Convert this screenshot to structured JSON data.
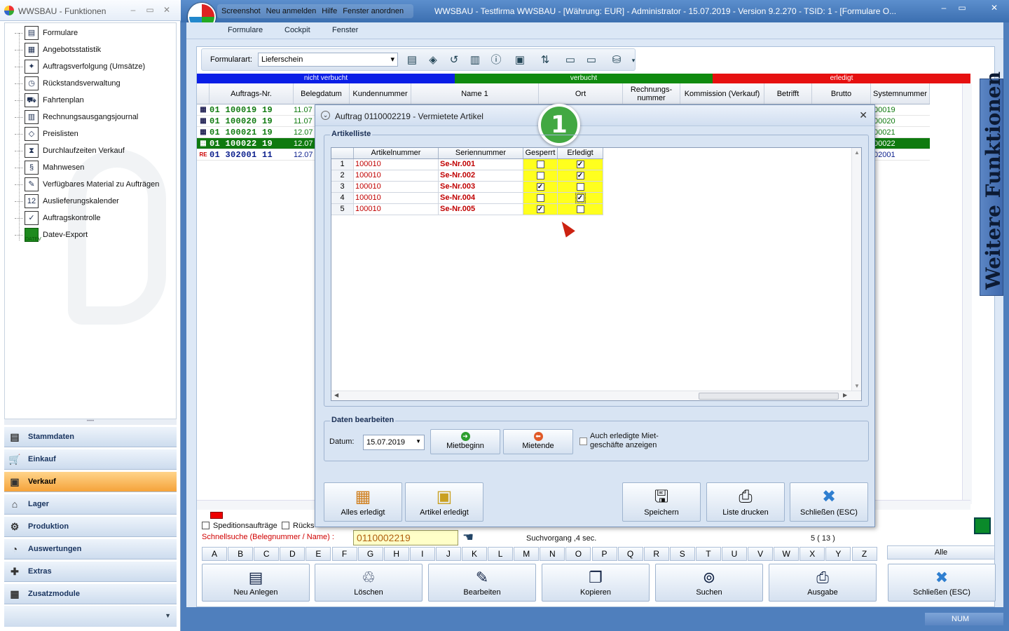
{
  "left_window": {
    "title": "WWSBAU - Funktionen",
    "tree": [
      {
        "label": "Formulare",
        "icon": "document-icon"
      },
      {
        "label": "Angebotsstatistik",
        "icon": "statistics-icon"
      },
      {
        "label": "Auftragsverfolgung (Umsätze)",
        "icon": "tracking-icon"
      },
      {
        "label": "Rückstandsverwaltung",
        "icon": "backlog-icon"
      },
      {
        "label": "Fahrtenplan",
        "icon": "truck-icon"
      },
      {
        "label": "Rechnungsausgangsjournal",
        "icon": "journal-icon"
      },
      {
        "label": "Preislisten",
        "icon": "price-tag-icon"
      },
      {
        "label": "Durchlaufzeiten Verkauf",
        "icon": "hourglass-icon"
      },
      {
        "label": "Mahnwesen",
        "icon": "dunning-icon"
      },
      {
        "label": "Verfügbares Material zu Aufträgen",
        "icon": "material-icon"
      },
      {
        "label": "Auslieferungskalender",
        "icon": "calendar-icon"
      },
      {
        "label": "Auftragskontrolle",
        "icon": "clipboard-check-icon"
      },
      {
        "label": "Datev-Export",
        "icon": "datev-icon",
        "icon_text": "DATEV"
      }
    ],
    "nav": [
      {
        "label": "Stammdaten",
        "icon": "master-data-icon",
        "active": false
      },
      {
        "label": "Einkauf",
        "icon": "cart-icon",
        "active": false
      },
      {
        "label": "Verkauf",
        "icon": "cash-register-icon",
        "active": true
      },
      {
        "label": "Lager",
        "icon": "warehouse-icon",
        "active": false
      },
      {
        "label": "Produktion",
        "icon": "production-icon",
        "active": false
      },
      {
        "label": "Auswertungen",
        "icon": "analysis-icon",
        "active": false
      },
      {
        "label": "Extras",
        "icon": "plus-tools-icon",
        "active": false
      },
      {
        "label": "Zusatzmodule",
        "icon": "modules-icon",
        "active": false
      }
    ]
  },
  "main_window": {
    "quick_access": [
      "Screenshot",
      "Neu anmelden",
      "Hilfe",
      "Fenster anordnen"
    ],
    "title": "WWSBAU - Testfirma WWSBAU - [Währung: EUR] - Administrator - 15.07.2019 - Version 9.2.270 - TSID: 1 - [Formulare O...",
    "menu": [
      "Formulare",
      "Cockpit",
      "Fenster"
    ],
    "toolbar": {
      "formularart_label": "Formularart:",
      "formularart_value": "Lieferschein"
    },
    "status_legend": [
      {
        "label": "nicht verbucht",
        "color": "#0a1ee6"
      },
      {
        "label": "verbucht",
        "color": "#0f8a0f"
      },
      {
        "label": "erledigt",
        "color": "#e61010"
      }
    ],
    "columns": [
      "Auftrags-Nr.",
      "Belegdatum",
      "Kundennummer",
      "Name 1",
      "Ort",
      "Rechnungs-nummer",
      "Kommission (Verkauf)",
      "Betrifft",
      "Brutto",
      "Systemnummer"
    ],
    "rows": [
      {
        "nr": "01 100019 19",
        "datum": "11.07",
        "system": "00019",
        "color": "#0f7a0f",
        "selected": false,
        "icon": "grid-icon"
      },
      {
        "nr": "01 100020 19",
        "datum": "11.07",
        "system": "00020",
        "color": "#0f7a0f",
        "selected": false,
        "icon": "grid-icon"
      },
      {
        "nr": "01 100021 19",
        "datum": "12.07",
        "system": "00021",
        "color": "#0f7a0f",
        "selected": false,
        "icon": "grid-icon"
      },
      {
        "nr": "01 100022 19",
        "datum": "12.07",
        "system": "00022",
        "color": "#ffffff",
        "selected": true,
        "icon": "grid-icon"
      },
      {
        "nr": "01 302001 11",
        "datum": "12.07",
        "system": "02001",
        "color": "#0a1e8c",
        "selected": false,
        "icon": "re-icon",
        "icon_text": "RE"
      }
    ],
    "side_tab": "Weitere Funktionen",
    "bottom": {
      "check1": "Speditionsaufträge",
      "check2": "Rücks",
      "quicksearch_label": "Schnellsuche (Belegnummer / Name) :",
      "quicksearch_value": "0110002219",
      "search_status": "Suchvorgang ,4 sec.",
      "count": "5 ( 13 )",
      "letters": [
        "A",
        "B",
        "C",
        "D",
        "E",
        "F",
        "G",
        "H",
        "I",
        "J",
        "K",
        "L",
        "M",
        "N",
        "O",
        "P",
        "Q",
        "R",
        "S",
        "T",
        "U",
        "V",
        "W",
        "X",
        "Y",
        "Z"
      ],
      "all_label": "Alle",
      "buttons": [
        {
          "label": "Neu Anlegen",
          "icon": "new-document-icon"
        },
        {
          "label": "Löschen",
          "icon": "recycle-bin-icon"
        },
        {
          "label": "Bearbeiten",
          "icon": "edit-icon"
        },
        {
          "label": "Kopieren",
          "icon": "copy-icon"
        },
        {
          "label": "Suchen",
          "icon": "binoculars-icon"
        },
        {
          "label": "Ausgabe",
          "icon": "printer-icon"
        },
        {
          "label": "Schließen (ESC)",
          "icon": "close-x-icon"
        }
      ]
    },
    "status_num": "NUM"
  },
  "dialog": {
    "title": "Auftrag 0110002219 - Vermietete Artikel",
    "badge": "1",
    "artikelliste_label": "Artikelliste",
    "columns": [
      "Artikelnummer",
      "Seriennummer",
      "Gesperrt",
      "Erledigt"
    ],
    "rows": [
      {
        "n": "1",
        "artikel": "100010",
        "serie": "Se-Nr.001",
        "gesperrt": false,
        "erledigt": true
      },
      {
        "n": "2",
        "artikel": "100010",
        "serie": "Se-Nr.002",
        "gesperrt": false,
        "erledigt": true
      },
      {
        "n": "3",
        "artikel": "100010",
        "serie": "Se-Nr.003",
        "gesperrt": true,
        "erledigt": false
      },
      {
        "n": "4",
        "artikel": "100010",
        "serie": "Se-Nr.004",
        "gesperrt": false,
        "erledigt": true
      },
      {
        "n": "5",
        "artikel": "100010",
        "serie": "Se-Nr.005",
        "gesperrt": true,
        "erledigt": false
      }
    ],
    "daten_label": "Daten bearbeiten",
    "datum_label": "Datum:",
    "datum_value": "15.07.2019",
    "mietbeginn": "Mietbeginn",
    "mietende": "Mietende",
    "auch_label": "Auch erledigte Miet-geschäfte anzeigen",
    "buttons": [
      {
        "label": "Alles erledigt",
        "icon": "all-done-icon"
      },
      {
        "label": "Artikel erledigt",
        "icon": "box-check-icon"
      },
      {
        "label": "Speichern",
        "icon": "save-icon"
      },
      {
        "label": "Liste drucken",
        "icon": "printer-icon"
      },
      {
        "label": "Schließen (ESC)",
        "icon": "close-x-icon"
      }
    ]
  }
}
